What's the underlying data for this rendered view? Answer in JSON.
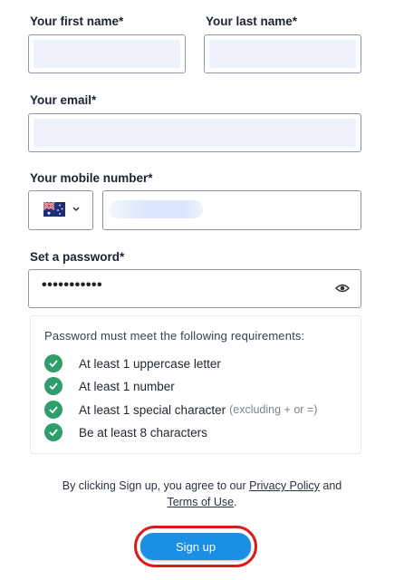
{
  "form": {
    "first_name": {
      "label": "Your first name*",
      "value": ""
    },
    "last_name": {
      "label": "Your last name*",
      "value": ""
    },
    "email": {
      "label": "Your email*",
      "value": ""
    },
    "mobile": {
      "label": "Your mobile number*",
      "country_icon": "australia-flag-icon",
      "value": ""
    },
    "password": {
      "label": "Set a password*",
      "masked_value": "•••••••••••",
      "toggle_icon": "eye-icon"
    }
  },
  "requirements": {
    "title": "Password must meet the following requirements:",
    "items": [
      {
        "text": "At least 1 uppercase letter",
        "note": "",
        "met": true
      },
      {
        "text": "At least 1 number",
        "note": "",
        "met": true
      },
      {
        "text": "At least 1 special character",
        "note": "(excluding + or =)",
        "met": true
      },
      {
        "text": "Be at least 8 characters",
        "note": "",
        "met": true
      }
    ]
  },
  "consent": {
    "prefix": "By clicking Sign up, you agree to our ",
    "privacy_link": "Privacy Policy",
    "middle": " and",
    "terms_link": "Terms of Use",
    "suffix": "."
  },
  "signup_button": {
    "label": "Sign up"
  },
  "colors": {
    "accent": "#1a8fe3",
    "success": "#2e9e6b",
    "highlight": "#d81c1c"
  }
}
